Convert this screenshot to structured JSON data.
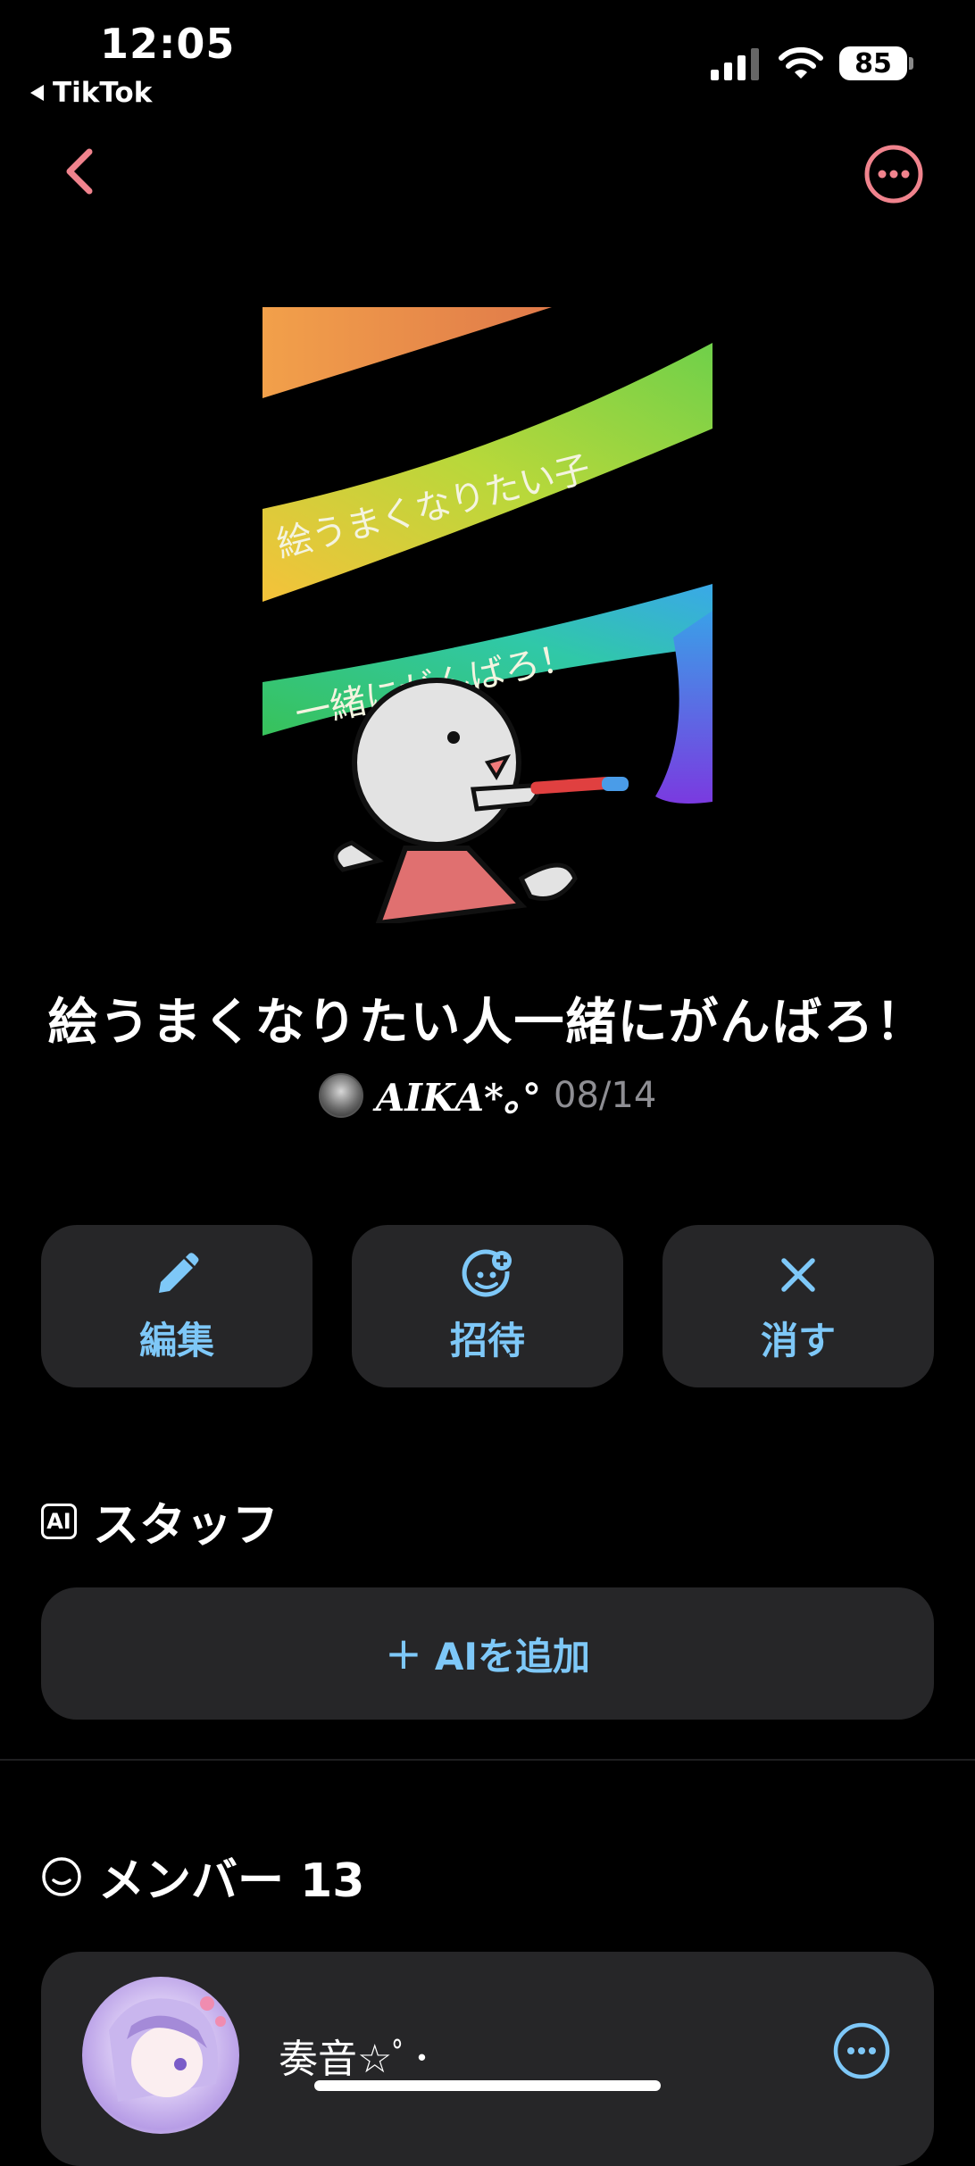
{
  "status_bar": {
    "time": "12:05",
    "back_app": "TikTok",
    "battery": "85"
  },
  "group": {
    "title": "絵うまくなりたい人一緒にがんばろ！",
    "author": "𝑨𝑰𝑲𝑨*｡°",
    "date": "08/14",
    "artwork_text": [
      "絵うまくなりたい子",
      "一緒にがんばろ！"
    ]
  },
  "actions": [
    {
      "label": "編集",
      "icon": "pencil-icon"
    },
    {
      "label": "招待",
      "icon": "invite-icon"
    },
    {
      "label": "消す",
      "icon": "close-icon"
    }
  ],
  "staff": {
    "badge": "AI",
    "heading": "スタッフ",
    "add_plus": "+",
    "add_label": "AIを追加"
  },
  "members": {
    "heading": "メンバー 13",
    "list": [
      {
        "name": "奏音☆ﾟ･"
      }
    ]
  },
  "colors": {
    "accent_pink": "#f0838d",
    "accent_blue": "#7ec8f8",
    "card": "#262628"
  }
}
